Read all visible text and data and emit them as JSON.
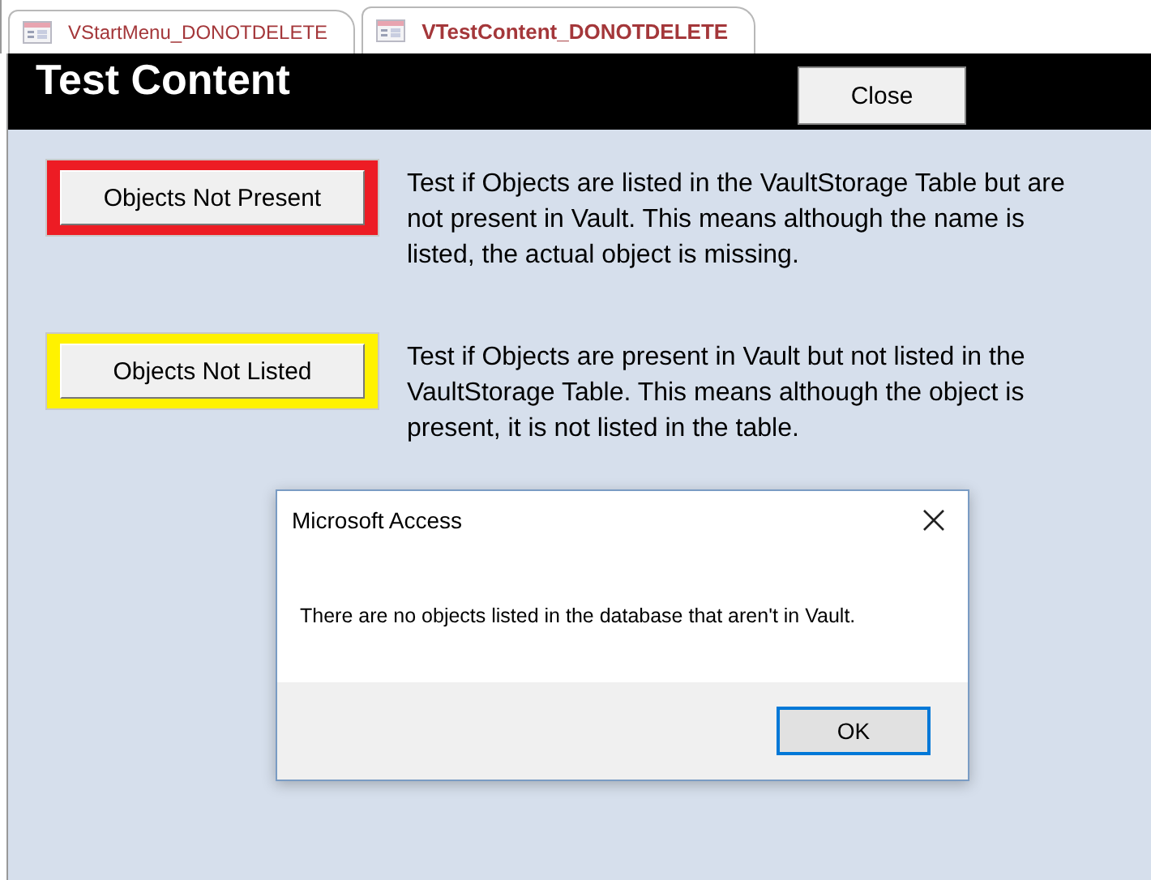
{
  "tabs": [
    {
      "label": "VStartMenu_DONOTDELETE",
      "selected": false
    },
    {
      "label": "VTestContent_DONOTDELETE",
      "selected": true
    }
  ],
  "form": {
    "title": "Test Content",
    "close_button": "Close"
  },
  "tests": [
    {
      "button": "Objects Not Present",
      "color": "#ed1c24",
      "description": "Test if Objects are listed in the VaultStorage Table but are not present in Vault. This means although the name is listed, the actual object is missing."
    },
    {
      "button": "Objects Not Listed",
      "color": "#fff200",
      "description": "Test if Objects are present in Vault but not listed in the VaultStorage Table. This means although the object is present, it is not listed in the table."
    }
  ],
  "dialog": {
    "title": "Microsoft Access",
    "message": "There are no objects listed in the database that aren't in Vault.",
    "button": "OK"
  }
}
